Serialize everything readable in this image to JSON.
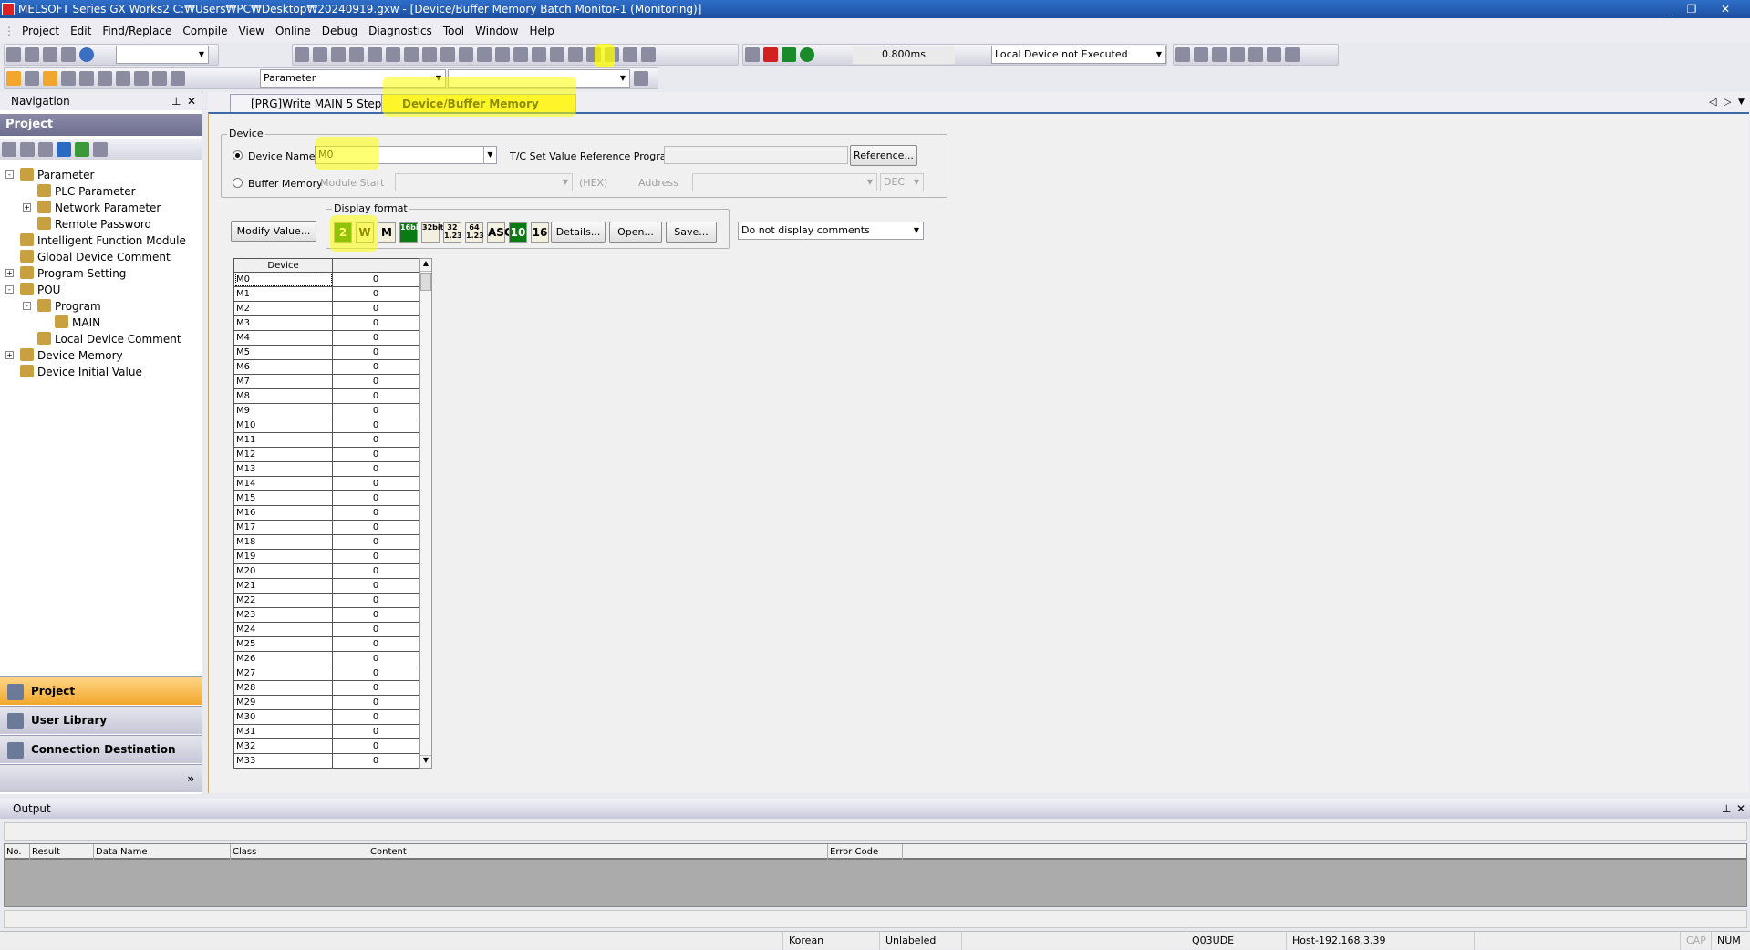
{
  "window": {
    "title": "MELSOFT Series GX Works2 C:₩Users₩PC₩Desktop₩20240919.gxw - [Device/Buffer Memory Batch Monitor-1 (Monitoring)]"
  },
  "menu": [
    "Project",
    "Edit",
    "Find/Replace",
    "Compile",
    "View",
    "Online",
    "Debug",
    "Diagnostics",
    "Tool",
    "Window",
    "Help"
  ],
  "toolbar": {
    "scan_time": "0.800ms",
    "local_device": "Local Device not Executed",
    "parameter_combo": "Parameter"
  },
  "navigation": {
    "title": "Navigation",
    "section": "Project",
    "tree": [
      {
        "label": "Parameter",
        "level": 0,
        "expand": "-"
      },
      {
        "label": "PLC Parameter",
        "level": 1
      },
      {
        "label": "Network Parameter",
        "level": 1,
        "expand": "+"
      },
      {
        "label": "Remote Password",
        "level": 1
      },
      {
        "label": "Intelligent Function Module",
        "level": 0
      },
      {
        "label": "Global Device Comment",
        "level": 0
      },
      {
        "label": "Program Setting",
        "level": 0,
        "expand": "+"
      },
      {
        "label": "POU",
        "level": 0,
        "expand": "-"
      },
      {
        "label": "Program",
        "level": 1,
        "expand": "-"
      },
      {
        "label": "MAIN",
        "level": 2
      },
      {
        "label": "Local Device Comment",
        "level": 1
      },
      {
        "label": "Device Memory",
        "level": 0,
        "expand": "+"
      },
      {
        "label": "Device Initial Value",
        "level": 0
      }
    ],
    "buttons": [
      "Project",
      "User Library",
      "Connection Destination"
    ]
  },
  "tabs": [
    {
      "label": "[PRG]Write MAIN 5 Step",
      "active": false
    },
    {
      "label": "Device/Buffer Memory Bat...",
      "active": true
    }
  ],
  "device_group": {
    "title": "Device",
    "device_name_label": "Device Name",
    "device_name_value": "M0",
    "tc_label": "T/C Set Value Reference Program",
    "reference_button": "Reference...",
    "buffer_memory_label": "Buffer Memory",
    "module_start_label": "Module Start",
    "hex_label": "(HEX)",
    "address_label": "Address",
    "dec_value": "DEC"
  },
  "modify_value_button": "Modify Value...",
  "display_format": {
    "title": "Display format",
    "buttons": [
      {
        "label": "2",
        "active": true
      },
      {
        "label": "W",
        "active": false
      },
      {
        "label": "M",
        "active": false
      },
      {
        "label": "16bit",
        "active": true
      },
      {
        "label": "32bit",
        "active": false
      },
      {
        "label": "32 1.23",
        "active": false
      },
      {
        "label": "64 1.23",
        "active": false
      },
      {
        "label": "ASC",
        "active": false
      },
      {
        "label": "10",
        "active": true
      },
      {
        "label": "16",
        "active": false
      }
    ],
    "details_button": "Details...",
    "open_button": "Open...",
    "save_button": "Save..."
  },
  "comment_select": "Do not display comments",
  "grid": {
    "header": "Device",
    "rows": [
      [
        "M0",
        "0"
      ],
      [
        "M1",
        "0"
      ],
      [
        "M2",
        "0"
      ],
      [
        "M3",
        "0"
      ],
      [
        "M4",
        "0"
      ],
      [
        "M5",
        "0"
      ],
      [
        "M6",
        "0"
      ],
      [
        "M7",
        "0"
      ],
      [
        "M8",
        "0"
      ],
      [
        "M9",
        "0"
      ],
      [
        "M10",
        "0"
      ],
      [
        "M11",
        "0"
      ],
      [
        "M12",
        "0"
      ],
      [
        "M13",
        "0"
      ],
      [
        "M14",
        "0"
      ],
      [
        "M15",
        "0"
      ],
      [
        "M16",
        "0"
      ],
      [
        "M17",
        "0"
      ],
      [
        "M18",
        "0"
      ],
      [
        "M19",
        "0"
      ],
      [
        "M20",
        "0"
      ],
      [
        "M21",
        "0"
      ],
      [
        "M22",
        "0"
      ],
      [
        "M23",
        "0"
      ],
      [
        "M24",
        "0"
      ],
      [
        "M25",
        "0"
      ],
      [
        "M26",
        "0"
      ],
      [
        "M27",
        "0"
      ],
      [
        "M28",
        "0"
      ],
      [
        "M29",
        "0"
      ],
      [
        "M30",
        "0"
      ],
      [
        "M31",
        "0"
      ],
      [
        "M32",
        "0"
      ],
      [
        "M33",
        "0"
      ]
    ]
  },
  "output": {
    "title": "Output",
    "columns": [
      "No.",
      "Result",
      "Data Name",
      "Class",
      "Content",
      "Error Code"
    ]
  },
  "status": {
    "language": "Korean",
    "label_state": "Unlabeled",
    "cpu": "Q03UDE",
    "connection": "Host-192.168.3.39",
    "cap": "CAP",
    "num": "NUM"
  },
  "colors": {
    "accent": "#3c6aa8",
    "active_tab": "#ffe95a",
    "format_active": "#0a7a12",
    "nav_active": "#f2a72c"
  }
}
